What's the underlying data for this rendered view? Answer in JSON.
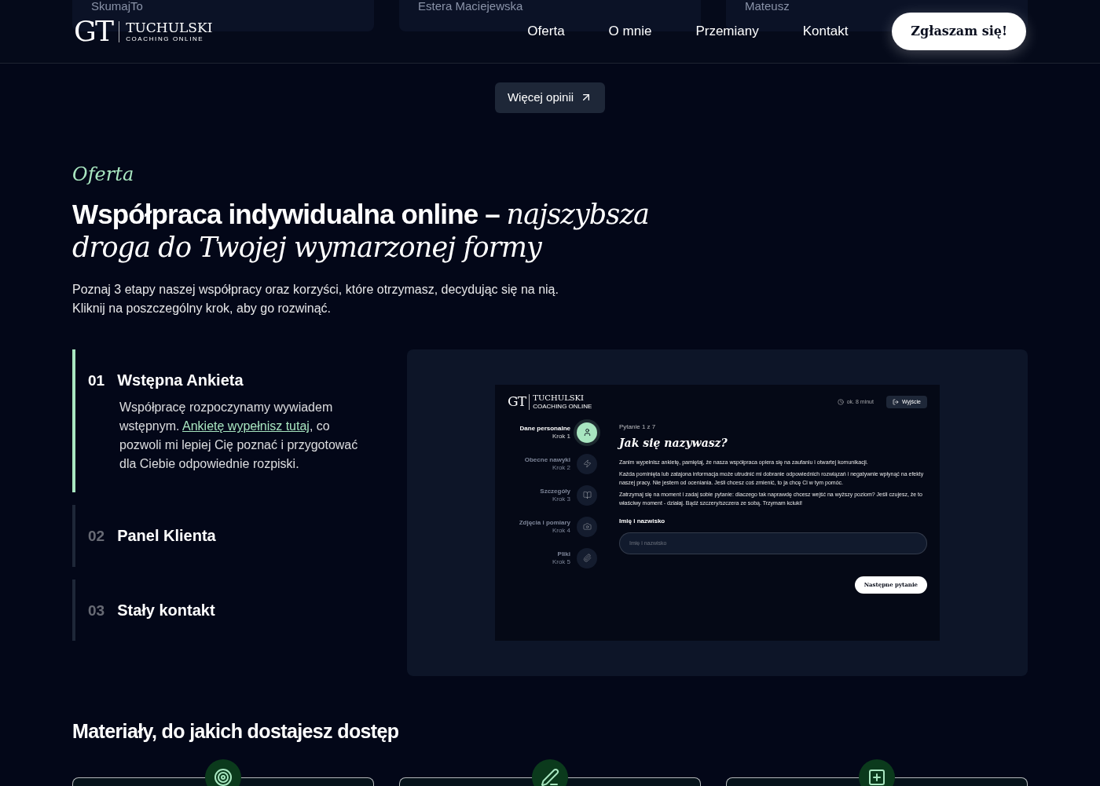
{
  "behind_header_cards": [
    "SkumajTo",
    "Estera Maciejewska",
    "Mateusz"
  ],
  "header": {
    "logo_mark": "GT",
    "logo_name": "TUCHULSKI",
    "logo_sub": "COACHING ONLINE",
    "nav": [
      "Oferta",
      "O mnie",
      "Przemiany",
      "Kontakt"
    ],
    "cta": "Zgłaszam się!"
  },
  "more_reviews": "Więcej opinii",
  "offer": {
    "eyebrow": "Oferta",
    "heading_plain": "Współpraca indywidualna online – ",
    "heading_italic": "najszybsza droga do Twojej wymarzonej formy",
    "intro": [
      "Poznaj 3 etapy naszej współpracy oraz korzyści, które otrzymasz, decydując się na nią.",
      "Kliknij na poszczególny krok, aby go rozwinąć."
    ]
  },
  "steps": [
    {
      "number": "01",
      "title": "Wstępna Ankieta",
      "expanded": true,
      "text_before": "Współpracę rozpoczynamy wywiadem wstępnym. ",
      "link": "Ankietę wypełnisz tutaj",
      "text_after": ", co pozwoli mi lepiej Cię poznać i przygotować dla Ciebie odpowiednie rozpiski."
    },
    {
      "number": "02",
      "title": "Panel Klienta",
      "expanded": false
    },
    {
      "number": "03",
      "title": "Stały kontakt",
      "expanded": false
    }
  ],
  "mockup": {
    "logo_mark": "GT",
    "logo_name": "TUCHULSKI",
    "logo_sub": "COACHING ONLINE",
    "time": "ok. 8 minut",
    "exit": "Wyjście",
    "steps": [
      {
        "label": "Dane personalne",
        "sub": "Krok 1",
        "selected": true
      },
      {
        "label": "Obecne nawyki",
        "sub": "Krok 2",
        "selected": false
      },
      {
        "label": "Szczegóły",
        "sub": "Krok 3",
        "selected": false
      },
      {
        "label": "Zdjęcia i pomiary",
        "sub": "Krok 4",
        "selected": false
      },
      {
        "label": "Pliki",
        "sub": "Krok 5",
        "selected": false
      }
    ],
    "counter": "Pytanie 1 z 7",
    "question": "Jak się nazywasz?",
    "paragraphs": [
      "Zanim wypełnisz ankietę, pamiętaj, że nasza współpraca opiera się na zaufaniu i otwartej komunikacji.",
      "Każda pominięta lub zatajona informacja może utrudnić mi dobranie odpowiednich rozwiązań i negatywnie wpłynąć na efekty naszej pracy. Nie jestem od oceniania. Jeśli chcesz coś zmienić, to ja chcę Ci w tym pomóc.",
      "Zatrzymaj się na moment i zadaj sobie pytanie: dlaczego tak naprawdę chcesz wejść na wyższy poziom? Jeśli czujesz, że to właściwy moment - działaj. Bądź szczery/szczera ze sobą. Trzymam kciuki!"
    ],
    "field_label": "Imię i nazwisko",
    "field_placeholder": "Imię i nazwisko",
    "next": "Następne pytanie"
  },
  "materials": {
    "heading": "Materiały, do jakich dostajesz dostęp",
    "cards": [
      {
        "kind": "target"
      },
      {
        "kind": "pen"
      },
      {
        "kind": "plus"
      }
    ]
  }
}
